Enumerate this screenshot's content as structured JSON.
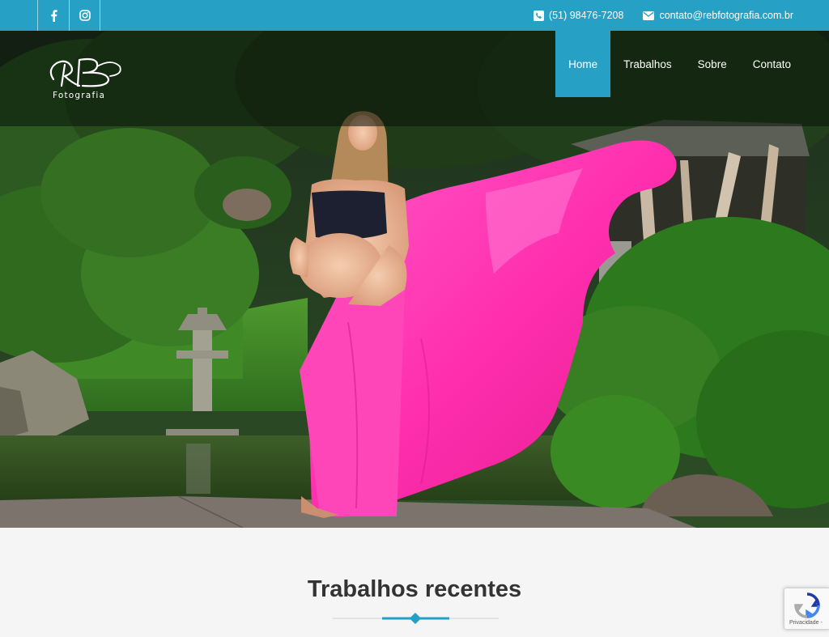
{
  "topbar": {
    "social": [
      {
        "name": "facebook-icon"
      },
      {
        "name": "instagram-icon"
      }
    ],
    "phone": "(51) 98476-7208",
    "email": "contato@rebfotografia.com.br",
    "color": "#26a0c4"
  },
  "logo": {
    "monogram": "RB",
    "wordmark": "Fotografia"
  },
  "nav": {
    "items": [
      {
        "label": "Home",
        "active": true
      },
      {
        "label": "Trabalhos"
      },
      {
        "label": "Sobre"
      },
      {
        "label": "Contato"
      }
    ]
  },
  "section": {
    "title": "Trabalhos recentes"
  },
  "recaptcha": {
    "label": "Privacidade -"
  }
}
